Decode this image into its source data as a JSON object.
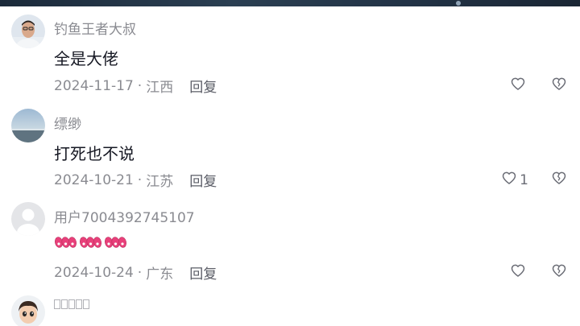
{
  "comments": [
    {
      "username": "钓鱼王者大叔",
      "text": "全是大佬",
      "date": "2024-11-17",
      "location": "江西",
      "reply_label": "回复",
      "like_count": ""
    },
    {
      "username": "缥缈",
      "text": "打死也不说",
      "date": "2024-10-21",
      "location": "江苏",
      "reply_label": "回复",
      "like_count": "1"
    },
    {
      "username": "用户7004392745107",
      "text": "",
      "date": "2024-10-24",
      "location": "广东",
      "reply_label": "回复",
      "like_count": ""
    }
  ],
  "meta_separator": "·",
  "icons": {
    "like": "heart-outline-icon",
    "dislike": "broken-heart-icon",
    "sticker": "666-sticker-icon"
  },
  "colors": {
    "username": "#8a8b91",
    "text": "#161823",
    "sticker": "#e8407a"
  }
}
